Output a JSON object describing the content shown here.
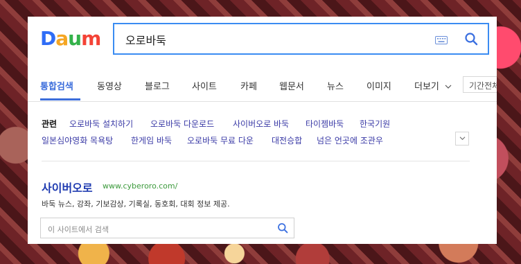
{
  "logo": {
    "letters": [
      "D",
      "a",
      "u",
      "m"
    ],
    "colors": [
      "#2f6df6",
      "#f5a623",
      "#34b24a",
      "#f44336"
    ]
  },
  "search": {
    "query": "오로바둑"
  },
  "icons": {
    "keyboard": "keyboard-icon",
    "search": "search-icon",
    "chevron": "chevron-down-icon"
  },
  "tabs": [
    "통합검색",
    "동영상",
    "블로그",
    "사이트",
    "카페",
    "웹문서",
    "뉴스",
    "이미지",
    "더보기"
  ],
  "period": "기간전체",
  "related": {
    "label": "관련",
    "links": [
      "오로바둑 설치하기",
      "오로바둑 다운로드",
      "사이버오로 바둑",
      "타이젬바둑",
      "한국기원",
      "일본심야영화 목욕탕",
      "한게임 바둑",
      "오로바둑 무료 다운",
      "대전승합",
      "넘은 언곳에 조관우"
    ]
  },
  "site": {
    "title": "사이버오로",
    "url": "www.cyberoro.com/",
    "description": "바둑 뉴스, 강좌, 기보감상, 기록실, 동호회, 대회 정보 제공.",
    "search_placeholder": "이 사이트에서 검색"
  },
  "accent": "#3b6ddb"
}
